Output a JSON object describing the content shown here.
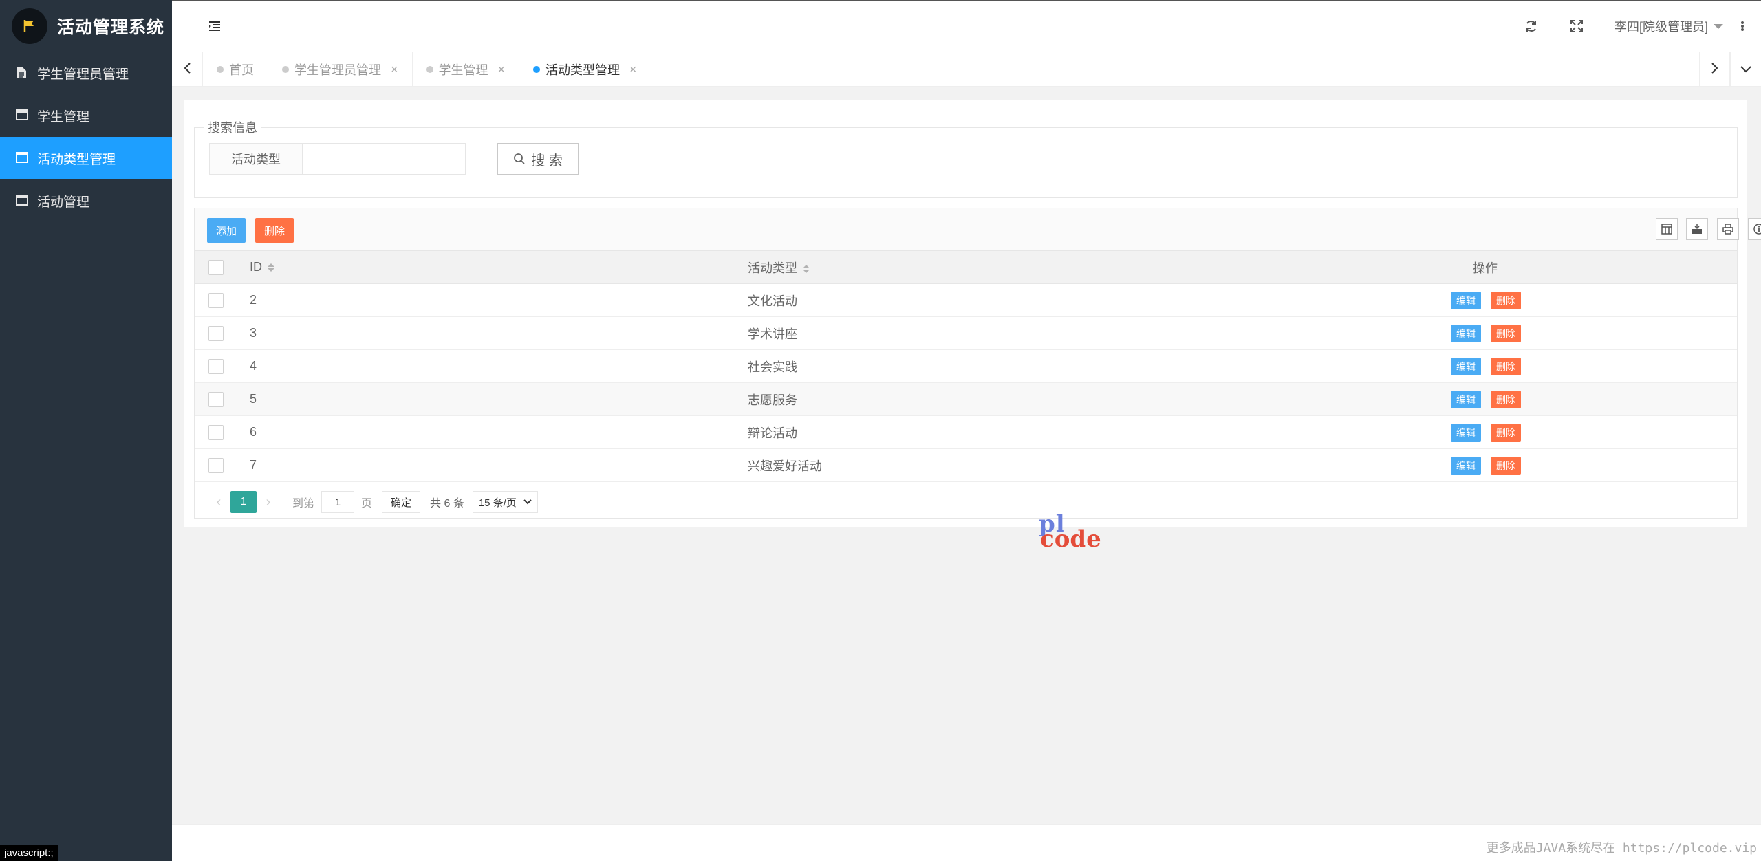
{
  "app": {
    "title": "活动管理系统"
  },
  "sidebar": {
    "items": [
      {
        "label": "学生管理员管理",
        "icon": "document-icon",
        "active": false
      },
      {
        "label": "学生管理",
        "icon": "window-icon",
        "active": false
      },
      {
        "label": "活动类型管理",
        "icon": "window-icon",
        "active": true
      },
      {
        "label": "活动管理",
        "icon": "window-icon",
        "active": false
      }
    ]
  },
  "header": {
    "user": "李四[院级管理员]"
  },
  "tabs": [
    {
      "label": "首页",
      "closable": false,
      "active": false
    },
    {
      "label": "学生管理员管理",
      "closable": true,
      "active": false
    },
    {
      "label": "学生管理",
      "closable": true,
      "active": false
    },
    {
      "label": "活动类型管理",
      "closable": true,
      "active": true
    }
  ],
  "search": {
    "legend": "搜索信息",
    "field_label": "活动类型",
    "field_value": "",
    "button_label": "搜 索"
  },
  "toolbar": {
    "add_label": "添加",
    "delete_label": "删除"
  },
  "table": {
    "columns": [
      "ID",
      "活动类型",
      "操作"
    ],
    "rows": [
      {
        "id": "2",
        "type": "文化活动"
      },
      {
        "id": "3",
        "type": "学术讲座"
      },
      {
        "id": "4",
        "type": "社会实践"
      },
      {
        "id": "5",
        "type": "志愿服务"
      },
      {
        "id": "6",
        "type": "辩论活动"
      },
      {
        "id": "7",
        "type": "兴趣爱好活动"
      }
    ],
    "edit_label": "编辑",
    "delete_label": "删除"
  },
  "pager": {
    "current_page": "1",
    "jump_prefix": "到第",
    "jump_value": "1",
    "jump_suffix": "页",
    "confirm_label": "确定",
    "total": "共 6 条",
    "limit": "15 条/页"
  },
  "watermark": {
    "line1": "pl",
    "line2": "code"
  },
  "footer": {
    "text": "更多成品JAVA系统尽在 https://plcode.vip"
  },
  "status_bar": {
    "text": "javascript:;"
  },
  "colors": {
    "sidebar": "#28333e",
    "accent": "#1e9fff",
    "add": "#4aabf4",
    "danger": "#ff7144",
    "pager_active": "#2fa69a"
  }
}
